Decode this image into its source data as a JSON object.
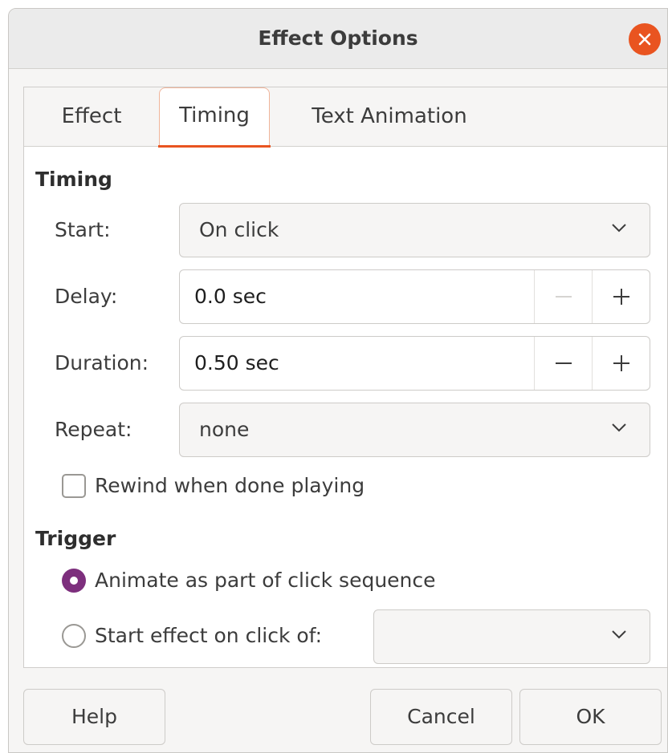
{
  "window": {
    "title": "Effect Options",
    "close_icon": "close-icon",
    "accent": "#e95420"
  },
  "tabs": [
    {
      "label": "Effect",
      "selected": false
    },
    {
      "label": "Timing",
      "selected": true
    },
    {
      "label": "Text Animation",
      "selected": false
    }
  ],
  "timing": {
    "heading": "Timing",
    "start": {
      "label": "Start:",
      "value": "On click"
    },
    "delay": {
      "label": "Delay:",
      "value": "0.0 sec"
    },
    "duration": {
      "label": "Duration:",
      "value": "0.50 sec"
    },
    "repeat": {
      "label": "Repeat:",
      "value": "none"
    },
    "rewind": {
      "label": "Rewind when done playing",
      "checked": false
    }
  },
  "trigger": {
    "heading": "Trigger",
    "option_sequence": {
      "label": "Animate as part of click sequence",
      "selected": true
    },
    "option_click_of": {
      "label": "Start effect on click of:",
      "selected": false,
      "value": ""
    },
    "radio_color": "#7d2f7d"
  },
  "footer": {
    "help": "Help",
    "cancel": "Cancel",
    "ok": "OK"
  }
}
